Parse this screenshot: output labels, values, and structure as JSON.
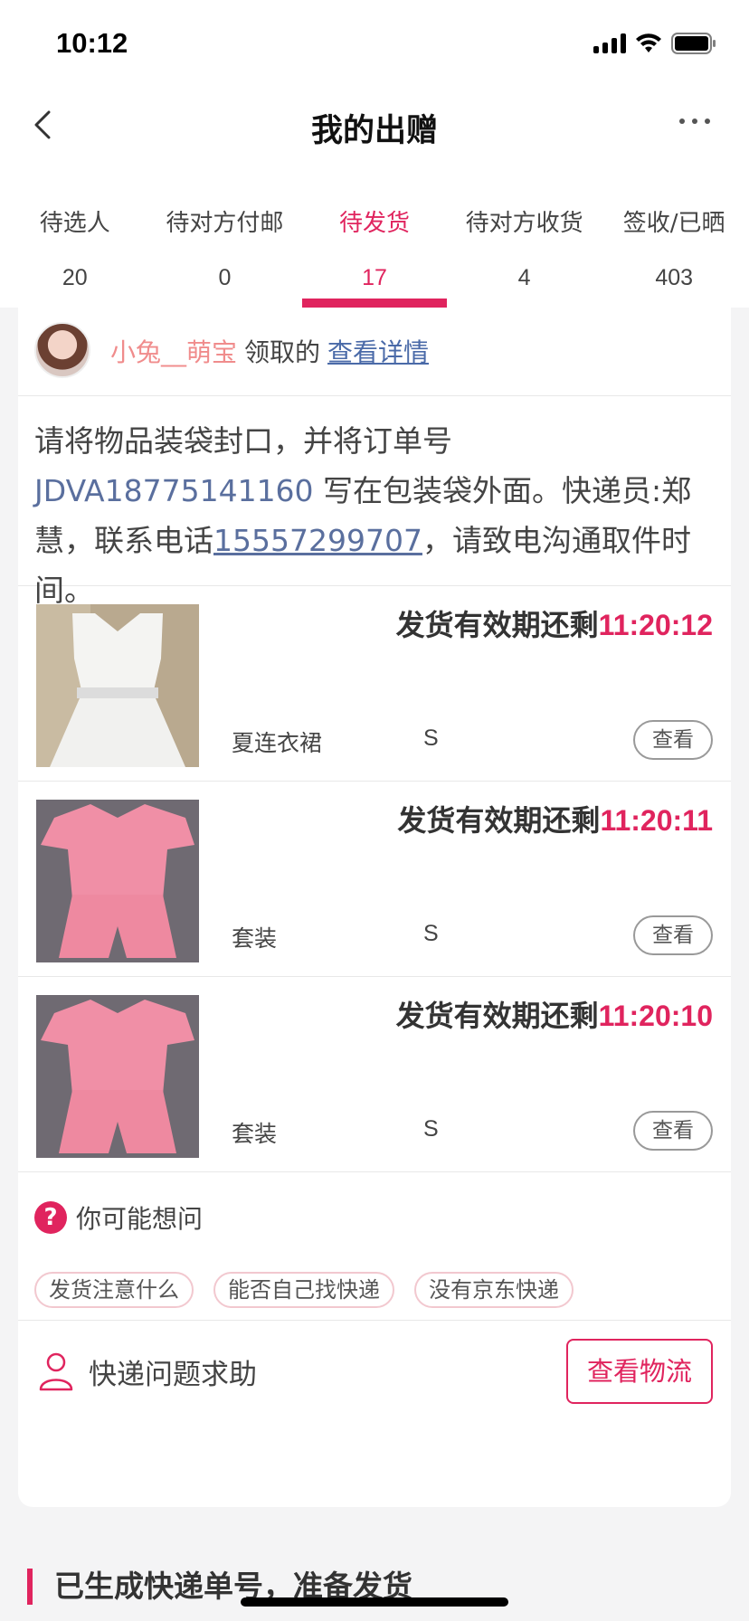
{
  "status_bar": {
    "time": "10:12"
  },
  "nav": {
    "title": "我的出赠"
  },
  "tabs": [
    {
      "label": "待选人",
      "count": "20"
    },
    {
      "label": "待对方付邮",
      "count": "0"
    },
    {
      "label": "待发货",
      "count": "17",
      "active": true
    },
    {
      "label": "待对方收货",
      "count": "4"
    },
    {
      "label": "签收/已晒",
      "count": "403"
    }
  ],
  "order": {
    "nickname": "小兔__萌宝",
    "verb": "领取的",
    "detail_link": "查看详情",
    "notice": {
      "part1": "请将物品装袋封口，并将订单号 ",
      "order_no": "JDVA18775141160",
      "part2": " 写在包装袋外面。快递员:郑慧，联系电话",
      "phone": "15557299707",
      "part3": "，请致电沟通取件时间。"
    },
    "items": [
      {
        "deadline_label": "发货有效期还剩",
        "timer": "11:20:12",
        "name": "夏连衣裙",
        "size": "S",
        "button": "查看",
        "image": "white-dress"
      },
      {
        "deadline_label": "发货有效期还剩",
        "timer": "11:20:11",
        "name": "套装",
        "size": "S",
        "button": "查看",
        "image": "pink-set"
      },
      {
        "deadline_label": "发货有效期还剩",
        "timer": "11:20:10",
        "name": "套装",
        "size": "S",
        "button": "查看",
        "image": "pink-set"
      }
    ],
    "faq": {
      "title": "你可能想问",
      "chips": [
        "发货注意什么",
        "能否自己找快递",
        "没有京东快递"
      ]
    },
    "help": {
      "label": "快递问题求助",
      "button": "查看物流"
    }
  },
  "section": {
    "title": "已生成快递单号，准备发货"
  },
  "colors": {
    "accent": "#e0245e",
    "link": "#5a6f9e",
    "nickname": "#f08c8c"
  }
}
